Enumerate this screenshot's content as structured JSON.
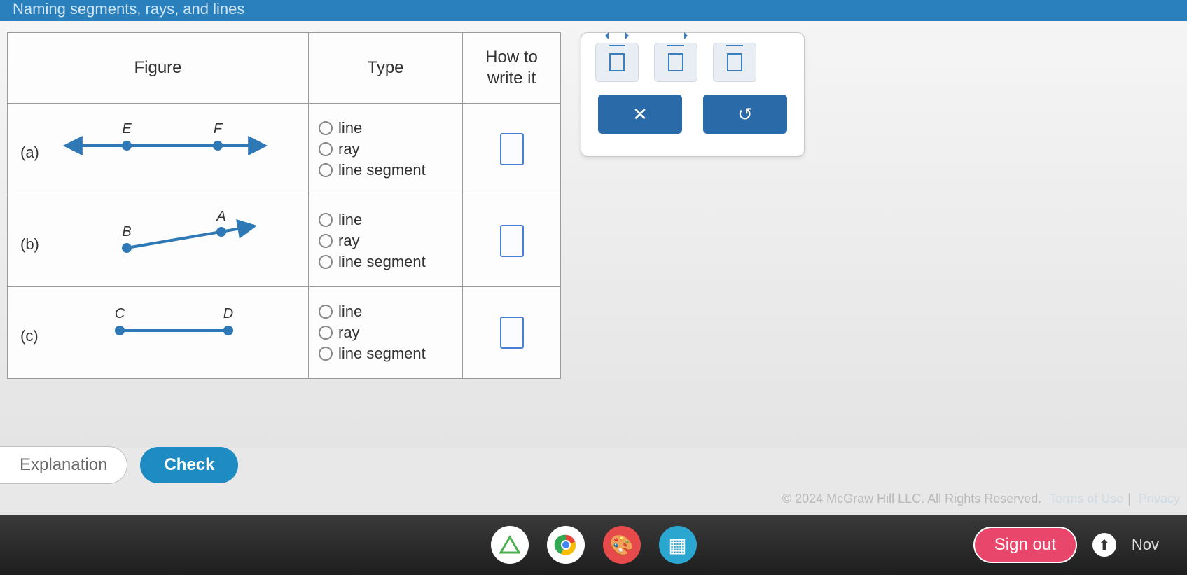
{
  "title": "Naming segments, rays, and lines",
  "headers": {
    "figure": "Figure",
    "type": "Type",
    "write": "How to\nwrite it"
  },
  "options": {
    "line": "line",
    "ray": "ray",
    "segment": "line segment"
  },
  "rows": [
    {
      "label": "(a)",
      "pt1": "E",
      "pt2": "F",
      "kind": "line"
    },
    {
      "label": "(b)",
      "pt1": "B",
      "pt2": "A",
      "kind": "ray"
    },
    {
      "label": "(c)",
      "pt1": "C",
      "pt2": "D",
      "kind": "segment"
    }
  ],
  "buttons": {
    "explanation": "Explanation",
    "check": "Check",
    "signout": "Sign out"
  },
  "footer": {
    "copyright": "© 2024 McGraw Hill LLC. All Rights Reserved.",
    "terms": "Terms of Use",
    "privacy": "Privacy"
  },
  "clock": "Nov"
}
